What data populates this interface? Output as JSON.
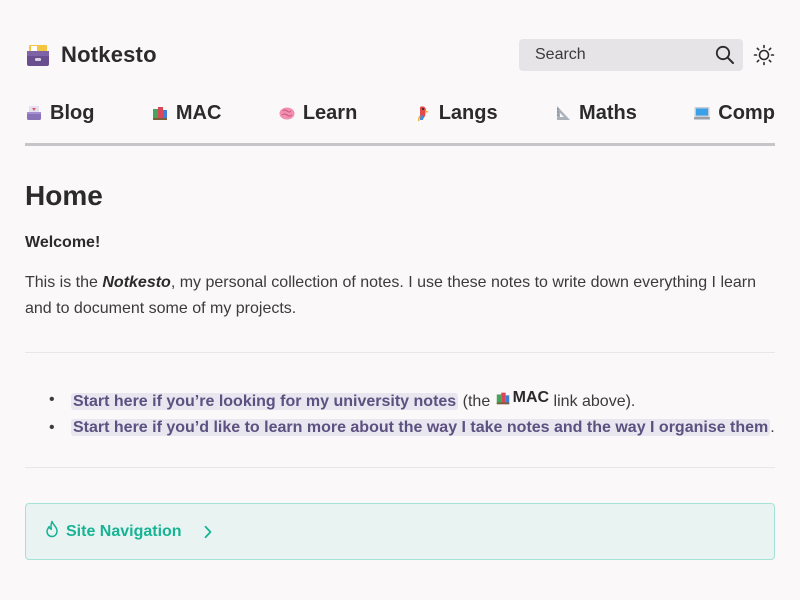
{
  "site": {
    "title": "Notkesto",
    "icon": "card-file-box-icon"
  },
  "search": {
    "placeholder": "Search",
    "icon": "search-icon"
  },
  "theme_toggle": {
    "icon": "sun-icon"
  },
  "nav": {
    "items": [
      {
        "label": "Blog",
        "icon": "inbox-tray-icon"
      },
      {
        "label": "MAC",
        "icon": "books-icon"
      },
      {
        "label": "Learn",
        "icon": "brain-icon"
      },
      {
        "label": "Langs",
        "icon": "parrot-icon"
      },
      {
        "label": "Maths",
        "icon": "triangular-ruler-icon"
      },
      {
        "label": "Comp",
        "icon": "computer-icon"
      }
    ]
  },
  "main": {
    "page_title": "Home",
    "welcome": "Welcome!",
    "intro_before": "This is the ",
    "intro_emphasis": "Notkesto",
    "intro_after": ", my personal collection of notes. I use these notes to write down everything I learn and to document some of my projects.",
    "links": [
      {
        "text": "Start here if you’re looking for my university notes",
        "suffix_before": " (the ",
        "suffix_icon": "books-icon",
        "suffix_bold": "MAC",
        "suffix_after": " link above)."
      },
      {
        "text": "Start here if you’d like to learn more about the way I take notes and the way I organise them",
        "suffix_after": "."
      }
    ]
  },
  "callout": {
    "title": "Site Navigation",
    "icon": "flame-icon",
    "chevron": "chevron-right-icon"
  },
  "colors": {
    "background": "#faf8f8",
    "link_text": "#5c5180",
    "link_bg": "#e8e6ef",
    "callout_accent": "#18b394",
    "callout_bg": "#e9f4f2"
  }
}
